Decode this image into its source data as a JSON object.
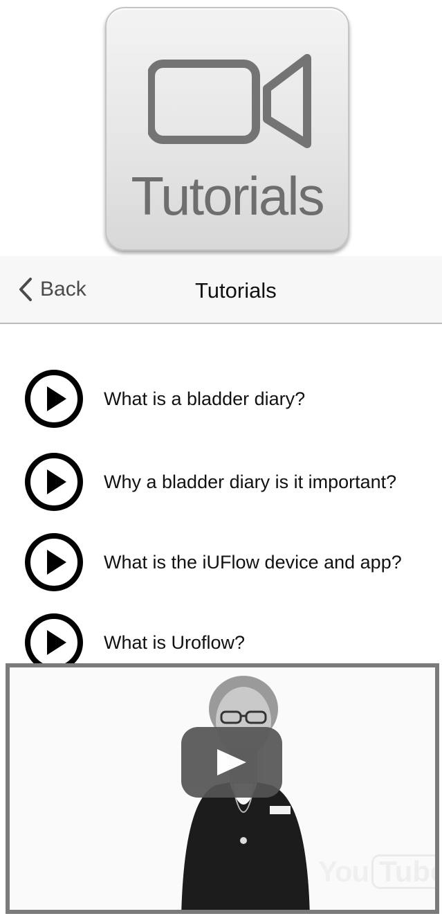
{
  "app_tile": {
    "label": "Tutorials",
    "icon": "video-camera-icon"
  },
  "navbar": {
    "back_label": "Back",
    "title": "Tutorials"
  },
  "tutorials": [
    {
      "label": "What is a bladder diary?",
      "icon": "play-circle-icon"
    },
    {
      "label": "Why a bladder diary is it important?",
      "icon": "play-circle-icon"
    },
    {
      "label": "What is the iUFlow device and app?",
      "icon": "play-circle-icon"
    },
    {
      "label": "What is Uroflow?",
      "icon": "play-circle-icon"
    }
  ],
  "video": {
    "logo_you": "You",
    "logo_tube": "Tube",
    "play_icon": "youtube-play-icon"
  }
}
